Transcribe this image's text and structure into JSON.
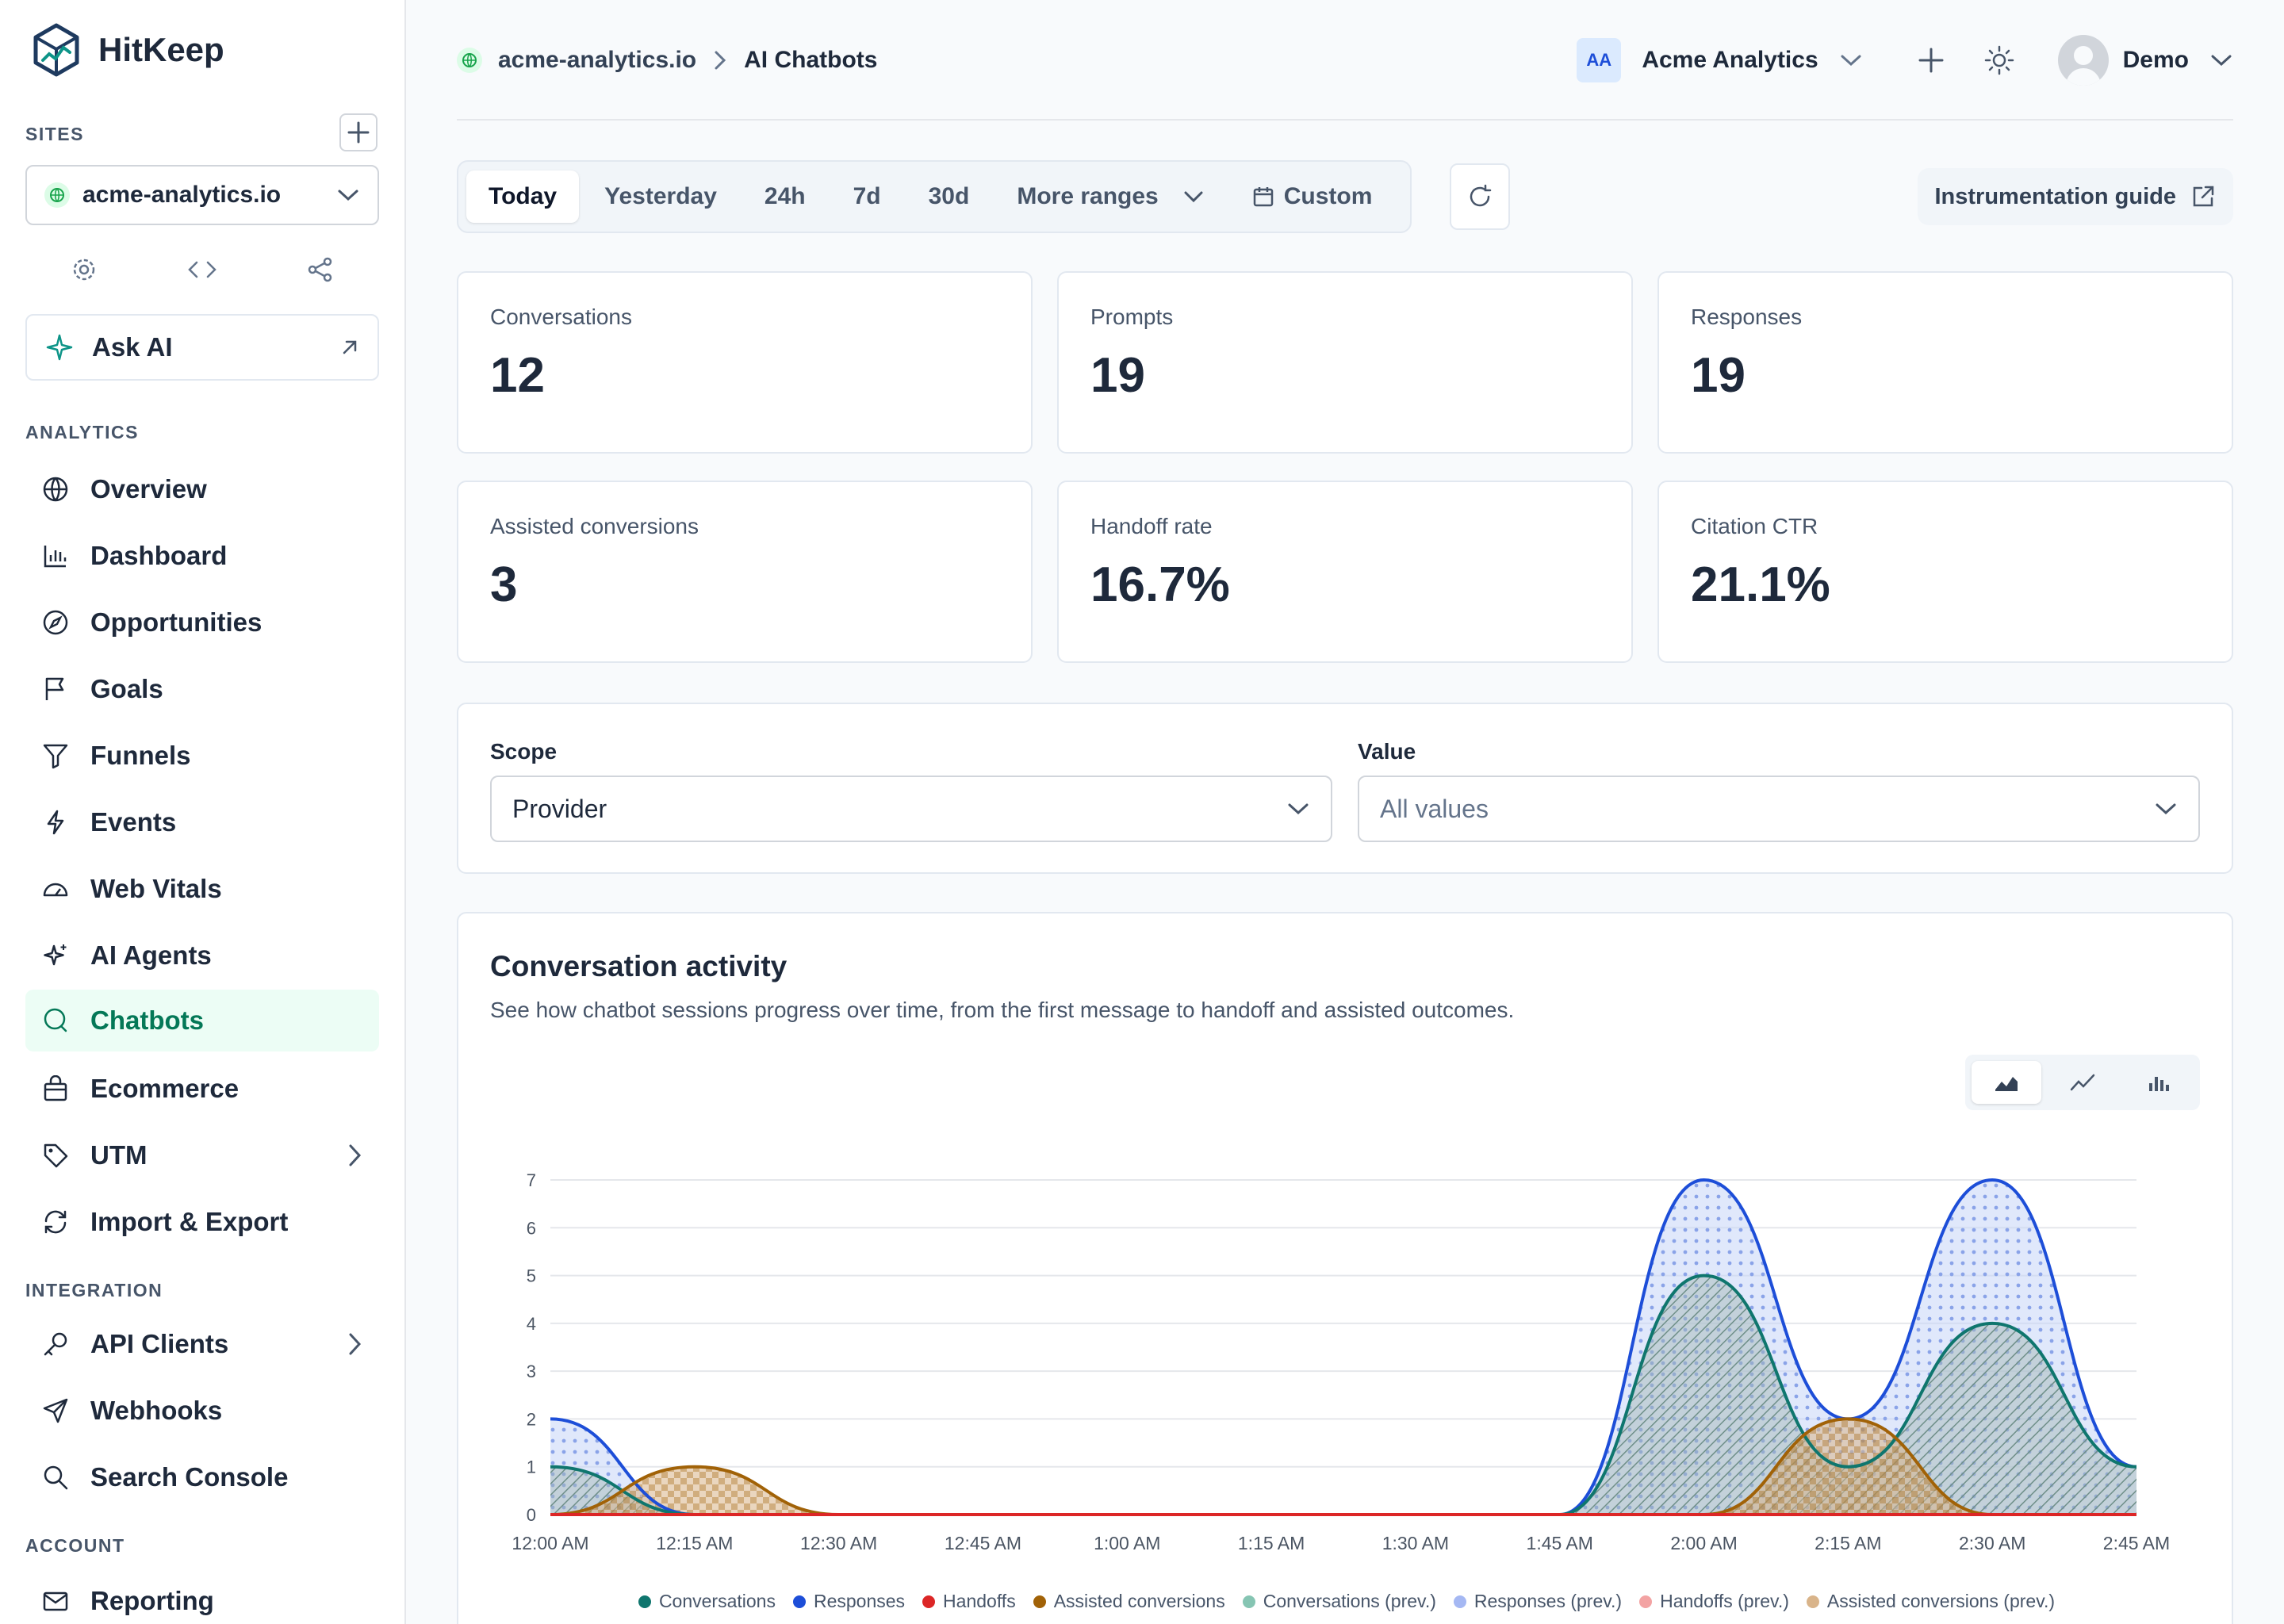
{
  "brand": {
    "name": "HitKeep"
  },
  "sidebar": {
    "sites_label": "SITES",
    "site_selected": "acme-analytics.io",
    "ask_ai": "Ask AI",
    "analytics_label": "ANALYTICS",
    "analytics_items": [
      {
        "label": "Overview",
        "icon": "globe-icon"
      },
      {
        "label": "Dashboard",
        "icon": "bar-chart-icon"
      },
      {
        "label": "Opportunities",
        "icon": "compass-icon"
      },
      {
        "label": "Goals",
        "icon": "flag-icon"
      },
      {
        "label": "Funnels",
        "icon": "funnel-icon"
      },
      {
        "label": "Events",
        "icon": "bolt-icon"
      },
      {
        "label": "Web Vitals",
        "icon": "gauge-icon"
      },
      {
        "label": "AI Agents",
        "icon": "sparkle-icon"
      },
      {
        "label": "Chatbots",
        "icon": "chat-icon",
        "active": true
      },
      {
        "label": "Ecommerce",
        "icon": "bag-icon"
      },
      {
        "label": "UTM",
        "icon": "tag-icon"
      },
      {
        "label": "Import & Export",
        "icon": "sync-icon"
      }
    ],
    "integration_label": "INTEGRATION",
    "integration_items": [
      {
        "label": "API Clients",
        "icon": "key-icon"
      },
      {
        "label": "Webhooks",
        "icon": "send-icon"
      },
      {
        "label": "Search Console",
        "icon": "search-icon"
      }
    ],
    "account_label": "ACCOUNT",
    "account_items": [
      {
        "label": "Reporting",
        "icon": "mail-icon"
      }
    ]
  },
  "header": {
    "site": "acme-analytics.io",
    "page": "AI Chatbots",
    "org_initials": "AA",
    "org_name": "Acme Analytics",
    "user": "Demo"
  },
  "ranges": {
    "tabs": [
      "Today",
      "Yesterday",
      "24h",
      "7d",
      "30d",
      "More ranges",
      "Custom"
    ],
    "active": "Today",
    "guide": "Instrumentation guide"
  },
  "stats": [
    {
      "label": "Conversations",
      "value": "12"
    },
    {
      "label": "Prompts",
      "value": "19"
    },
    {
      "label": "Responses",
      "value": "19"
    },
    {
      "label": "Assisted conversions",
      "value": "3"
    },
    {
      "label": "Handoff rate",
      "value": "16.7%"
    },
    {
      "label": "Citation CTR",
      "value": "21.1%"
    }
  ],
  "filters": {
    "scope_label": "Scope",
    "scope_value": "Provider",
    "value_label": "Value",
    "value_value": "All values"
  },
  "chart_card": {
    "title": "Conversation activity",
    "subtitle": "See how chatbot sessions progress over time, from the first message to handoff and assisted outcomes."
  },
  "chart_data": {
    "type": "area",
    "x": [
      "12:00 AM",
      "12:15 AM",
      "12:30 AM",
      "12:45 AM",
      "1:00 AM",
      "1:15 AM",
      "1:30 AM",
      "1:45 AM",
      "2:00 AM",
      "2:15 AM",
      "2:30 AM",
      "2:45 AM"
    ],
    "ylim": [
      0,
      7
    ],
    "yticks": [
      0,
      1,
      2,
      3,
      4,
      5,
      6,
      7
    ],
    "grid": true,
    "legend_position": "bottom",
    "series": [
      {
        "name": "Conversations",
        "color": "#0f766e",
        "values": [
          1,
          0,
          0,
          0,
          0,
          0,
          0,
          0,
          5,
          1,
          4,
          1
        ]
      },
      {
        "name": "Responses",
        "color": "#1d4ed8",
        "values": [
          2,
          0,
          0,
          0,
          0,
          0,
          0,
          0,
          7,
          2,
          7,
          1
        ]
      },
      {
        "name": "Handoffs",
        "color": "#dc2626",
        "values": [
          0,
          0,
          0,
          0,
          0,
          0,
          0,
          0,
          0,
          0,
          0,
          0
        ]
      },
      {
        "name": "Assisted conversions",
        "color": "#a16207",
        "values": [
          0,
          1,
          0,
          0,
          0,
          0,
          0,
          0,
          0,
          2,
          0,
          0
        ]
      },
      {
        "name": "Conversations (prev.)",
        "color": "#86c5b3"
      },
      {
        "name": "Responses (prev.)",
        "color": "#a5b8f3"
      },
      {
        "name": "Handoffs (prev.)",
        "color": "#f3a3a3"
      },
      {
        "name": "Assisted conversions (prev.)",
        "color": "#d9b48a"
      }
    ]
  }
}
